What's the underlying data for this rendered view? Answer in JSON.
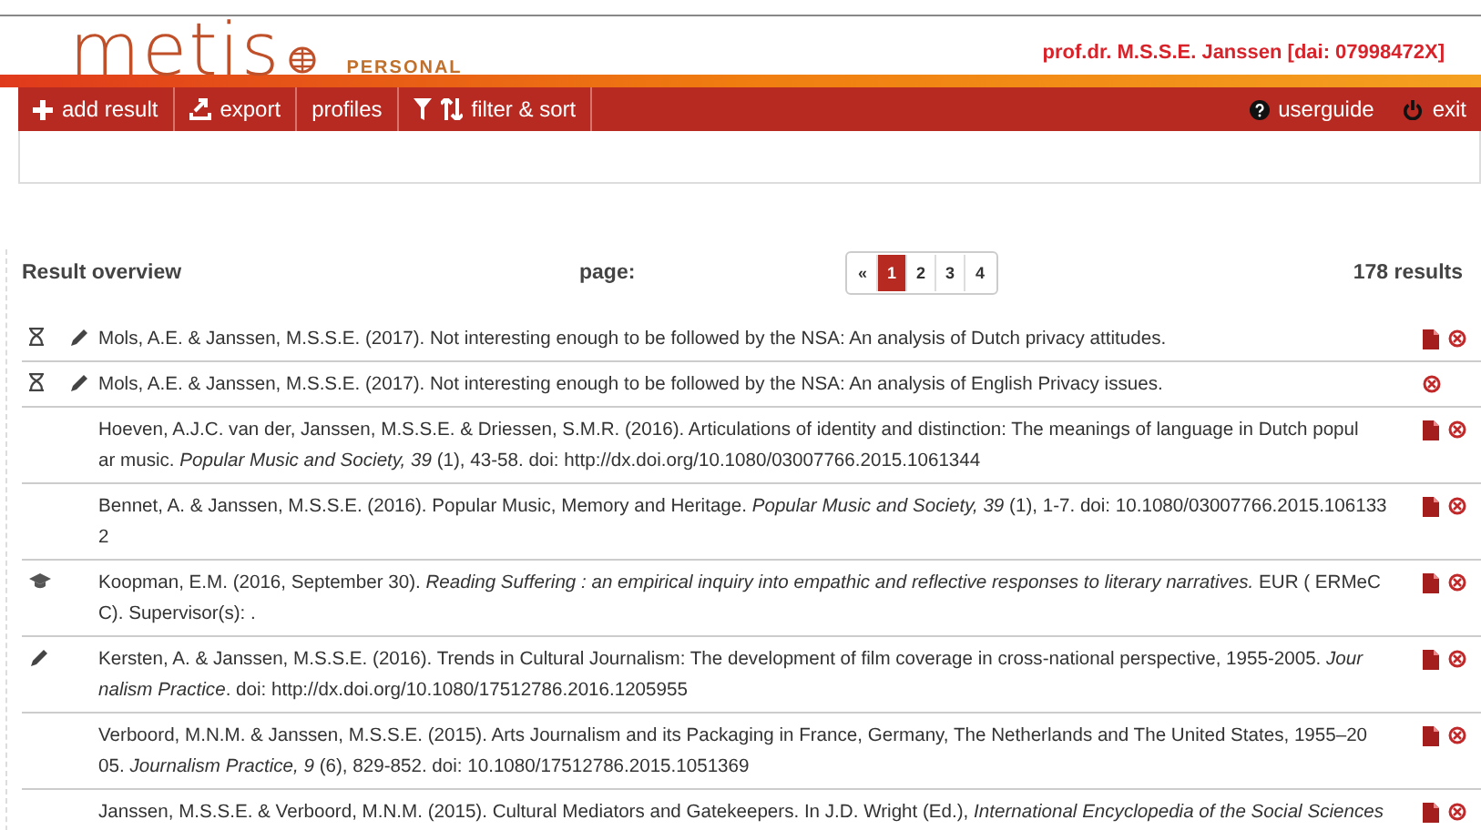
{
  "header": {
    "logo": "metis",
    "edition": "PERSONAL",
    "user": "prof.dr. M.S.S.E. Janssen [dai: 07998472X]"
  },
  "toolbar": {
    "left": [
      {
        "kind": "add",
        "label": "add result"
      },
      {
        "kind": "export",
        "label": "export"
      },
      {
        "kind": "plain",
        "label": "profiles"
      },
      {
        "kind": "filter",
        "label": "filter & sort"
      }
    ],
    "right": [
      {
        "kind": "help",
        "label": "userguide"
      },
      {
        "kind": "power",
        "label": "exit"
      }
    ]
  },
  "overview": {
    "title": "Result overview",
    "page_label": "page:",
    "prev": "«",
    "pages": [
      {
        "label": "1",
        "selected": true
      },
      {
        "label": "2",
        "selected": false
      },
      {
        "label": "3",
        "selected": false
      },
      {
        "label": "4",
        "selected": false
      }
    ],
    "count": "178 results"
  },
  "results": [
    {
      "pending": true,
      "editable": true,
      "thesis": false,
      "lines": [
        "Mols, A.E. & Janssen, M.S.S.E. (2017). Not interesting enough to be followed by the NSA: An analysis of Dutch privacy attitudes."
      ],
      "pdf": true
    },
    {
      "pending": true,
      "editable": true,
      "thesis": false,
      "lines": [
        "Mols, A.E. & Janssen, M.S.S.E. (2017). Not interesting enough to be followed by the NSA: An analysis of English Privacy issues."
      ],
      "pdf": false
    },
    {
      "pending": false,
      "editable": false,
      "thesis": false,
      "lines": [
        "Hoeven, A.J.C. van der, Janssen, M.S.S.E. & Driessen, S.M.R. (2016). Articulations of identity and distinction: The meanings of language in Dutch popul",
        "ar music. *Popular Music and Society, 39* (1), 43-58. doi: http://dx.doi.org/10.1080/03007766.2015.1061344"
      ],
      "pdf": true
    },
    {
      "pending": false,
      "editable": false,
      "thesis": false,
      "lines": [
        "Bennet, A. & Janssen, M.S.S.E. (2016). Popular Music, Memory and Heritage. *Popular Music and Society, 39* (1), 1-7. doi: 10.1080/03007766.2015.106133",
        "2"
      ],
      "pdf": true
    },
    {
      "pending": false,
      "editable": false,
      "thesis": true,
      "lines": [
        "Koopman, E.M. (2016, September 30). *Reading Suffering : an empirical inquiry into empathic and reflective responses to literary narratives.* EUR ( ERMeC",
        "C). Supervisor(s): ."
      ],
      "pdf": true
    },
    {
      "pending": false,
      "editable": true,
      "thesis": false,
      "lines": [
        "Kersten, A. & Janssen, M.S.S.E. (2016). Trends in Cultural Journalism: The development of film coverage in cross-national perspective, 1955-2005. *Jour*",
        "*nalism Practice*. doi: http://dx.doi.org/10.1080/17512786.2016.1205955"
      ],
      "pdf": true
    },
    {
      "pending": false,
      "editable": false,
      "thesis": false,
      "lines": [
        "Verboord, M.N.M. & Janssen, M.S.S.E. (2015). Arts Journalism and its Packaging in France, Germany, The Netherlands and The United States, 1955–20",
        "05. *Journalism Practice, 9* (6), 829-852. doi: 10.1080/17512786.2015.1051369"
      ],
      "pdf": true
    },
    {
      "pending": false,
      "editable": false,
      "thesis": false,
      "lines": [
        "Janssen, M.S.S.E. & Verboord, M.N.M. (2015). Cultural Mediators and Gatekeepers. In J.D. Wright (Ed.), *International Encyclopedia of the Social Sciences*"
      ],
      "pdf": true
    }
  ]
}
